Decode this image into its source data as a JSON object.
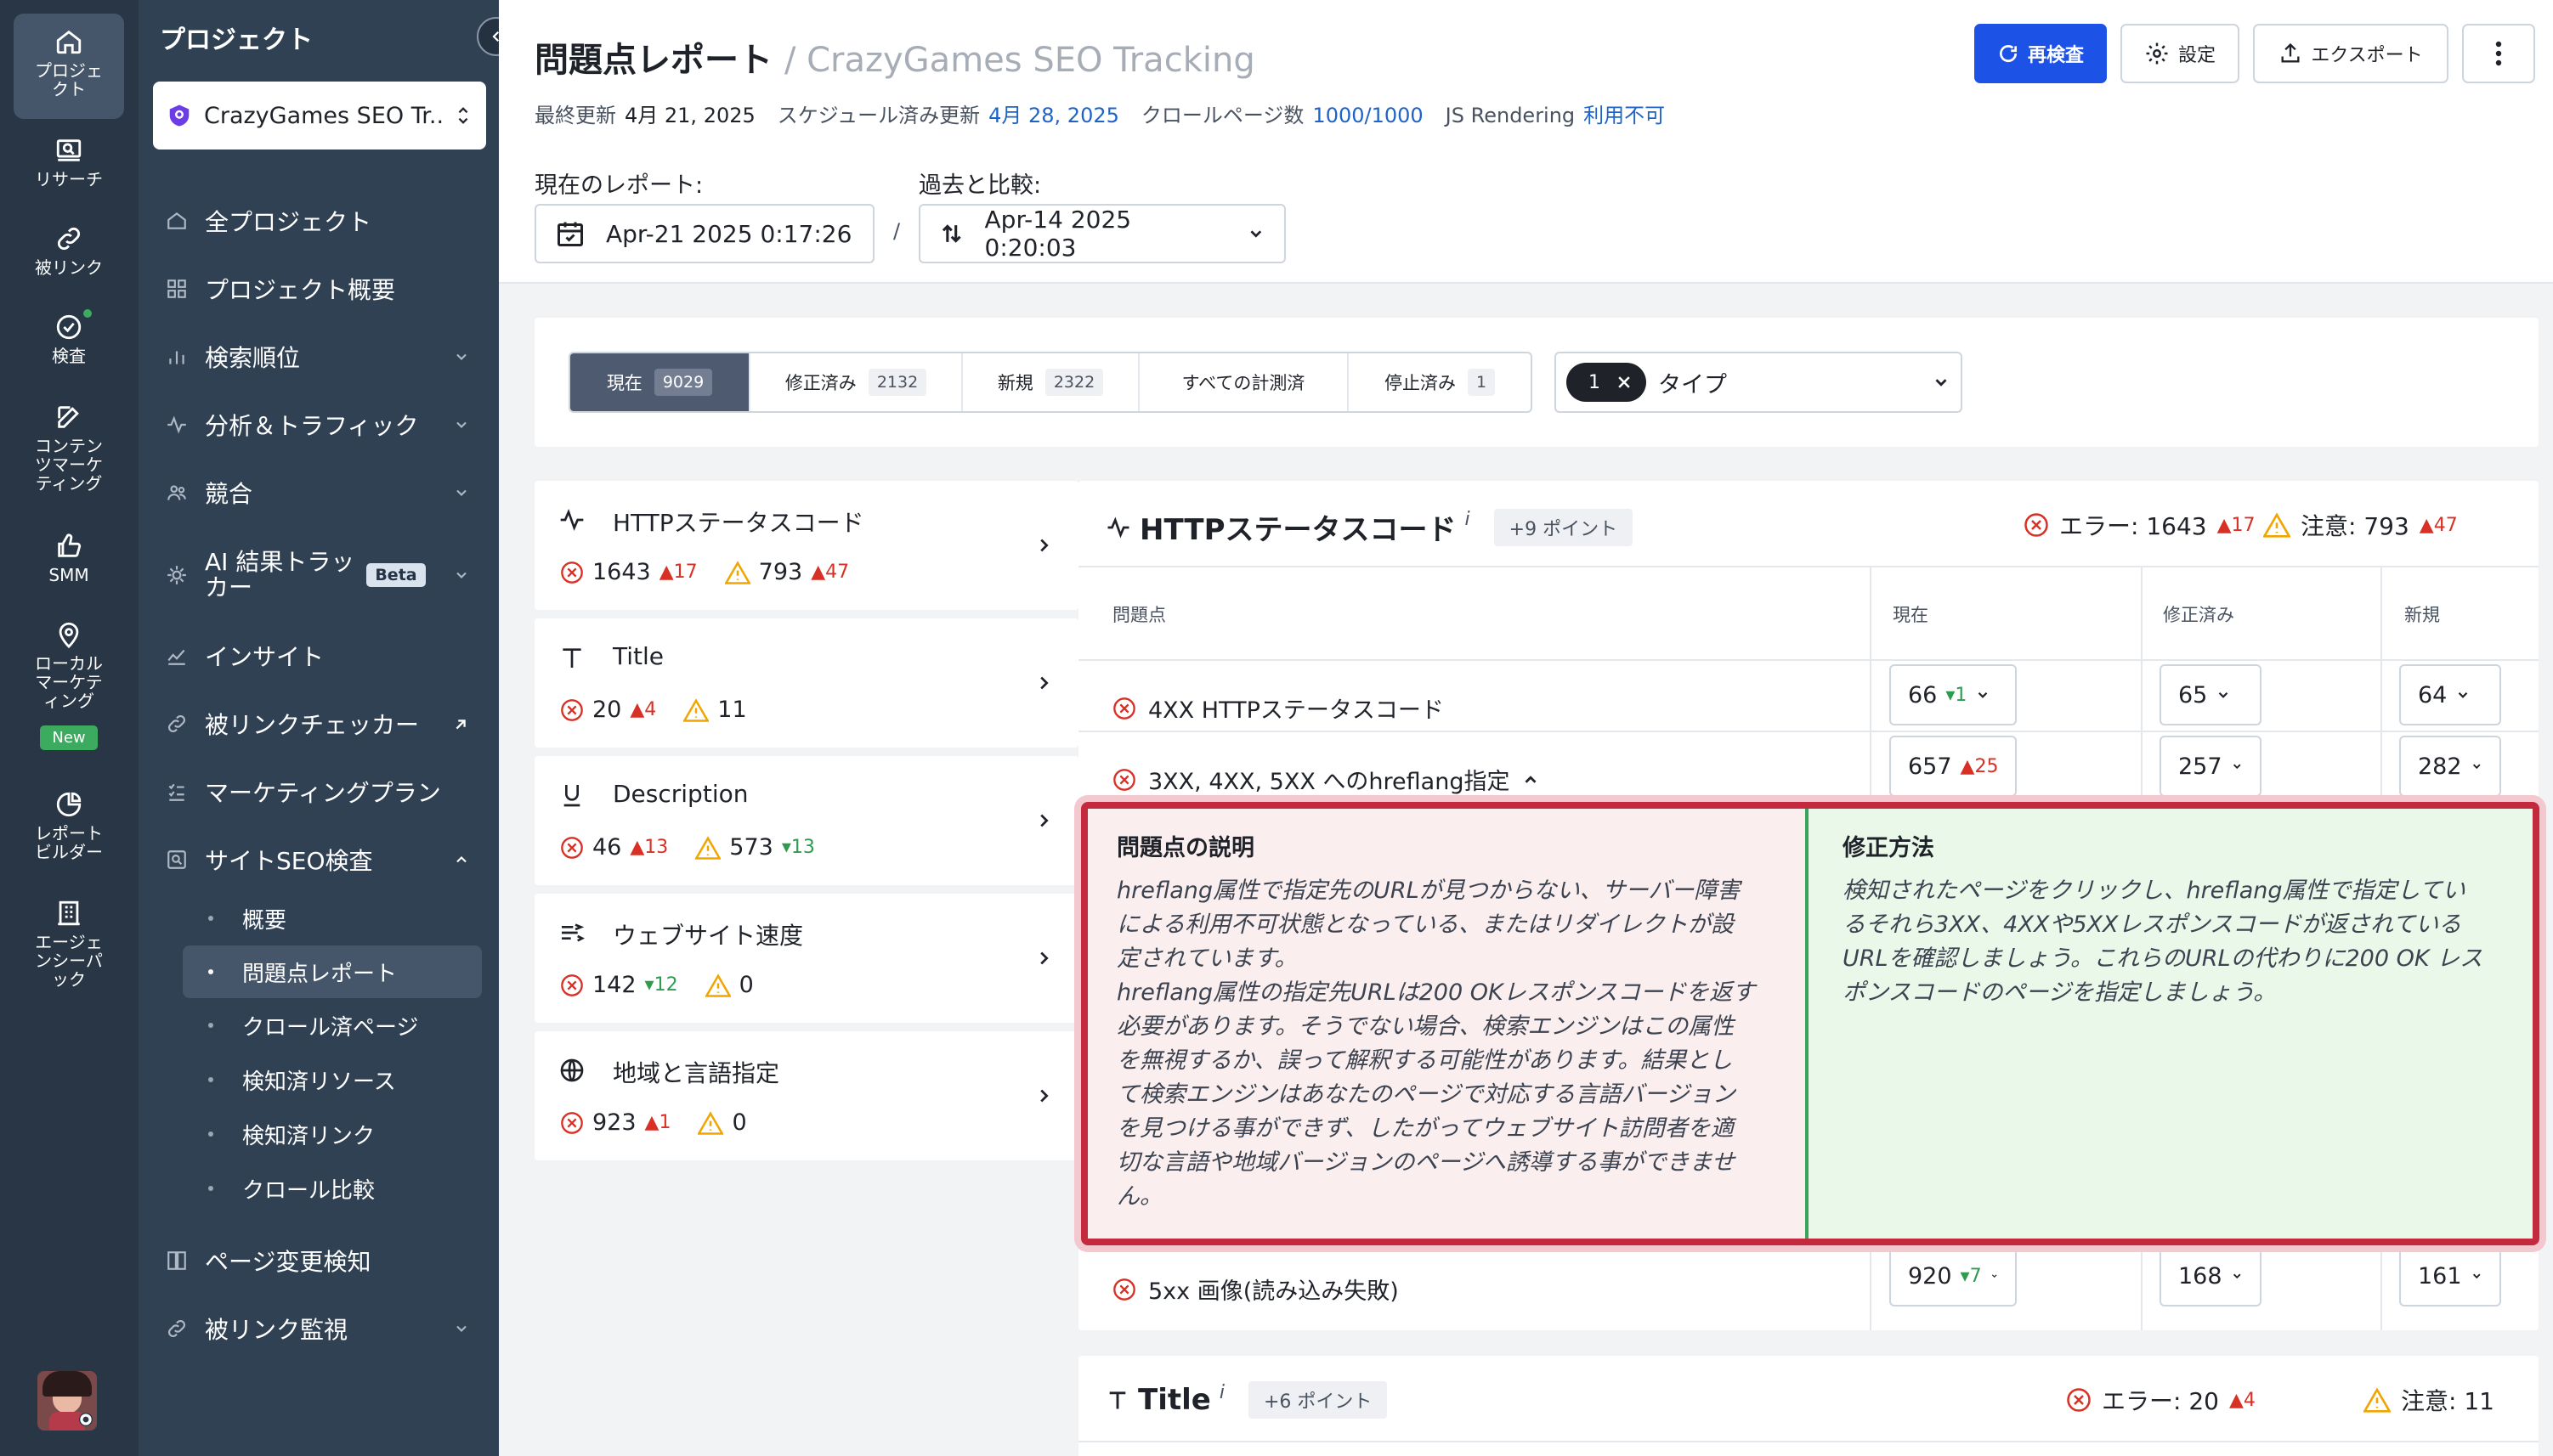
{
  "rail": {
    "items": [
      {
        "label": "プロジェ\nクト",
        "icon": "home-icon",
        "active": true
      },
      {
        "label": "リサーチ",
        "icon": "research-icon"
      },
      {
        "label": "被リンク",
        "icon": "link-icon"
      },
      {
        "label": "検査",
        "icon": "check-circle-icon"
      },
      {
        "label": "コンテン\nツマーケ\nティング",
        "icon": "edit-icon"
      },
      {
        "label": "SMM",
        "icon": "thumbs-up-icon"
      },
      {
        "label": "ローカル\nマーケテ\nィング",
        "icon": "location-pin-icon",
        "badge": "New"
      },
      {
        "label": "レポート\nビルダー",
        "icon": "pie-chart-icon"
      },
      {
        "label": "エージェ\nンシーパ\nック",
        "icon": "building-icon"
      }
    ]
  },
  "sidebar": {
    "title": "プロジェクト",
    "project_name": "CrazyGames SEO Tr...",
    "nav": [
      {
        "label": "全プロジェクト",
        "icon": "home-icon"
      },
      {
        "label": "プロジェクト概要",
        "icon": "grid-icon"
      },
      {
        "label": "検索順位",
        "icon": "bar-chart-icon",
        "chevron": true
      },
      {
        "label": "分析＆トラフィック",
        "icon": "pulse-icon",
        "chevron": true
      },
      {
        "label": "競合",
        "icon": "users-icon",
        "chevron": true
      },
      {
        "label": "AI 結果トラッ\nカー",
        "icon": "ai-icon",
        "chevron": true,
        "badge": "Beta"
      },
      {
        "label": "インサイト",
        "icon": "trend-icon"
      },
      {
        "label": "被リンクチェッカー",
        "icon": "link-icon",
        "external": true
      },
      {
        "label": "マーケティングプラン",
        "icon": "checklist-icon"
      },
      {
        "label": "サイトSEO検査",
        "icon": "search-doc-icon",
        "expanded": true
      }
    ],
    "sub": [
      {
        "label": "概要"
      },
      {
        "label": "問題点レポート",
        "active": true
      },
      {
        "label": "クロール済ページ"
      },
      {
        "label": "検知済リソース"
      },
      {
        "label": "検知済リンク"
      },
      {
        "label": "クロール比較"
      }
    ],
    "nav_bottom": [
      {
        "label": "ページ変更検知",
        "icon": "page-compare-icon"
      },
      {
        "label": "被リンク監視",
        "icon": "link-icon",
        "chevron": true
      }
    ]
  },
  "header": {
    "title": "問題点レポート",
    "crumb": "/ CrazyGames SEO Tracking",
    "meta": {
      "last_update_label": "最終更新",
      "last_update": "4月 21, 2025",
      "scheduled_label": "スケジュール済み更新",
      "scheduled": "4月 28, 2025",
      "crawled_label": "クロールページ数",
      "crawled": "1000/1000",
      "js_label": "JS Rendering",
      "js": "利用不可"
    },
    "recheck": "再検査",
    "settings": "設定",
    "export": "エクスポート",
    "current_label": "現在のレポート:",
    "current_date": "Apr-21 2025 0:17:26",
    "compare_label": "過去と比較:",
    "compare_date": "Apr-14 2025 0:20:03",
    "slash": "/"
  },
  "filters": {
    "tabs": [
      {
        "label": "現在",
        "count": "9029",
        "active": true
      },
      {
        "label": "修正済み",
        "count": "2132"
      },
      {
        "label": "新規",
        "count": "2322"
      },
      {
        "label": "すべての計測済",
        "count": ""
      },
      {
        "label": "停止済み",
        "count": "1"
      }
    ],
    "type_count": "1",
    "type_label": "タイプ"
  },
  "categories": [
    {
      "name": "HTTPステータスコード",
      "icon": "pulse-icon",
      "err": "1643",
      "err_d": "▲17",
      "err_dir": "up",
      "warn": "793",
      "warn_d": "▲47",
      "warn_dir": "up"
    },
    {
      "name": "Title",
      "icon": "text-t-icon",
      "err": "20",
      "err_d": "▲4",
      "err_dir": "up",
      "warn": "11",
      "warn_d": "",
      "warn_dir": ""
    },
    {
      "name": "Description",
      "icon": "underline-icon",
      "err": "46",
      "err_d": "▲13",
      "err_dir": "up",
      "warn": "573",
      "warn_d": "▾13",
      "warn_dir": "dn"
    },
    {
      "name": "ウェブサイト速度",
      "icon": "speed-icon",
      "err": "142",
      "err_d": "▾12",
      "err_dir": "dn",
      "warn": "0",
      "warn_d": "",
      "warn_dir": ""
    },
    {
      "name": "地域と言語指定",
      "icon": "globe-icon",
      "err": "923",
      "err_d": "▲1",
      "err_dir": "up",
      "warn": "0",
      "warn_d": "",
      "warn_dir": ""
    }
  ],
  "http_panel": {
    "title": "HTTPステータスコード",
    "info": "i",
    "points": "+9 ポイント",
    "err_label": "エラー: 1643",
    "err_d": "▲17",
    "warn_label": "注意: 793",
    "warn_d": "▲47",
    "columns": [
      "問題点",
      "現在",
      "修正済み",
      "新規"
    ],
    "rows": [
      {
        "name": "4XX HTTPステータスコード",
        "current": "66",
        "cur_d": "▾1",
        "cur_dir": "dn",
        "fixed": "65",
        "new": "64"
      },
      {
        "name": "3XX, 4XX, 5XX へのhreflang指定",
        "current": "657",
        "cur_d": "▲25",
        "cur_dir": "up",
        "fixed": "257",
        "new": "282",
        "expanded": true
      },
      {
        "name": "5xx 画像(読み込み失敗)",
        "current": "920",
        "cur_d": "▾7",
        "cur_dir": "dn",
        "fixed": "168",
        "new": "161"
      }
    ],
    "desc_heading": "問題点の説明",
    "desc_text": "hreflang属性で指定先のURLが見つからない、サーバー障害\nによる利用不可状態となっている、またはリダイレクトが設\n定されています。\nhreflang属性の指定先URLは200 OKレスポンスコードを返す\n必要があります。そうでない場合、検索エンジンはこの属性\nを無視するか、誤って解釈する可能性があります。結果とし\nて検索エンジンはあなたのページで対応する言語バージョン\nを見つける事ができず、したがってウェブサイト訪問者を適\n切な言語や地域バージョンのページへ誘導する事ができませ\nん。",
    "fix_heading": "修正方法",
    "fix_text": "検知されたページをクリックし、hreflang属性で指定してい\nるそれら3XX、4XXや5XXレスポンスコードが返されている\nURLを確認しましょう。これらのURLの代わりに200 OK レス\nポンスコードのページを指定しましょう。"
  },
  "title_panel": {
    "title": "Title",
    "info": "i",
    "points": "+6 ポイント",
    "err_label": "エラー: 20",
    "err_d": "▲4",
    "warn_label": "注意: 11"
  },
  "colors": {
    "rail": "#283646",
    "sidebar": "#314154",
    "accent": "#1c52e6",
    "error": "#d93025",
    "success": "#2e9b4e",
    "highlight": "#c42a3d"
  }
}
